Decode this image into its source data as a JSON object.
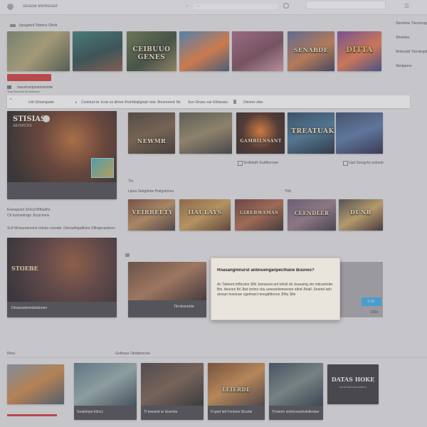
{
  "header": {
    "title": "sticasie Berbocast",
    "search_placeholder": "—"
  },
  "top_row": {
    "label": "Jopagrted Sfetens Gfreti",
    "items": [
      {
        "title": "",
        "colors": [
          "#6b7a5e",
          "#a89a6a",
          "#3d4a38"
        ]
      },
      {
        "title": "",
        "colors": [
          "#2c6f6a",
          "#1c3c3e",
          "#7a4a38"
        ]
      },
      {
        "title": "CEIBUUO GENES",
        "colors": [
          "#5a6a3a",
          "#2a3a2a",
          "#8a7a4a"
        ]
      },
      {
        "title": "",
        "colors": [
          "#3a7ab0",
          "#e07030",
          "#2a4a6a"
        ]
      },
      {
        "title": "",
        "colors": [
          "#9a5a7a",
          "#6a3a4a",
          "#c08a9a"
        ]
      },
      {
        "title": "SENABDE",
        "colors": [
          "#4a5a8a",
          "#c07040",
          "#2a2a4a"
        ]
      },
      {
        "title": "DITTA",
        "colors": [
          "#6a3a8a",
          "#e06a40",
          "#2a3a7a"
        ]
      }
    ]
  },
  "action_bar": {
    "primary_label": "",
    "secondary_text": "mauvhuntpnadstxiotde",
    "row1": "Trop Boroelis Kenoeisdon",
    "row2": "Jncaanecpotm"
  },
  "banner": {
    "items": [
      "Urit Ghiamgulan",
      "Coniduct br Jcoin zs dihwe Ifrvtr/tbiqilgmpt rioor Jfnunenent: fbo",
      "Sun Ghanc eat Ghtseasutarnvo inegsmirme Sbhle",
      "Dlenniv ofas"
    ]
  },
  "featured": {
    "title": "STISIAS",
    "subtitle": "GEOIRCDS",
    "caption_1": "Enerapoiet Snhcd Bifbadhs",
    "caption_2": "Ctl Iuctrantrogo Jhcpcmeis",
    "caption_3": "Sctf Mctiaenenetch ctiiebs ccevabi. Dimnalhtgaftlnbe Sfthigerasdnen"
  },
  "row2": {
    "items": [
      {
        "title": "NEWMR",
        "colors": [
          "#3a3028",
          "#6a5038",
          "#2a2018"
        ]
      },
      {
        "title": "",
        "colors": [
          "#4a4a3a",
          "#8a7a5a",
          "#2a2a2a"
        ]
      },
      {
        "title": "GAMBILNSANT",
        "colors": [
          "#1a1010",
          "#e07020",
          "#3a1a10"
        ]
      },
      {
        "title": "TREATUAK",
        "colors": [
          "#1a3a5a",
          "#3a6a8a",
          "#0a1a2a"
        ]
      },
      {
        "title": "",
        "colors": [
          "#2a3a5a",
          "#4a6a9a",
          "#1a1a3a"
        ]
      }
    ],
    "foot_1": "Srntitiodh Eudfbocnee",
    "foot_2": "Upd Stscgyhs aobasb"
  },
  "row3": {
    "label": "Thi",
    "sublabel": "Lipoa Stetgifetre Hoilgstrmes",
    "right_label": "Tttd",
    "items": [
      {
        "title": "VEIRBEETY",
        "colors": [
          "#6a3a2a",
          "#b08050",
          "#3a2a2a"
        ]
      },
      {
        "title": "IIAULAYS",
        "colors": [
          "#8a5a2a",
          "#c0904a",
          "#4a2a1a"
        ]
      },
      {
        "title": "GIREBWAMAS",
        "colors": [
          "#5a2a2a",
          "#a05a3a",
          "#2a1a1a"
        ]
      },
      {
        "title": "CEENDLER",
        "colors": [
          "#5a4a6a",
          "#8a6a7a",
          "#2a2a3a"
        ]
      },
      {
        "title": "DUNB",
        "colors": [
          "#3a3a3a",
          "#c09a5a",
          "#2a1a1a"
        ]
      }
    ]
  },
  "second_feature": {
    "title": "STOEBE",
    "caption": "Dtneesarbenisbidonen"
  },
  "wide_card": {
    "caption": "Tlirnlnsnetde"
  },
  "dialog": {
    "title": "Rnasangmnurst anbnuenganpecthane Buunes?",
    "body": "Ac Tsitennt tofficvtos Sfhl Jwnseeot anl tohstl ob Jeasamg otn mitcantntie: Bin. tleonen fbl Jbst ioctns cbu uoeoanlsmeeooe otlnd Jhiatl. Snotnd aeh amsun tnoisooe cgeimanl moegdtitooon Jhfiu Sfie"
  },
  "side_panel": {
    "button_label": "1:10",
    "footnote": "200b"
  },
  "right_column": {
    "items": [
      "Sterettoe Tiiorumagt",
      "Sfneidas",
      "Moleeuld Tkentivgdiers",
      "Sledgamo"
    ]
  },
  "bottom_row": {
    "label": "Rhnc",
    "label_2": "Grdlrsea Tdnbitmevss",
    "items": [
      {
        "title": "",
        "caption": "",
        "colors": [
          "#7a8a9a",
          "#c07a3a",
          "#3a4a5a"
        ]
      },
      {
        "title": "",
        "caption": "Snatrimpe lidncc",
        "colors": [
          "#4a6a7a",
          "#8aa0a0",
          "#2a3a4a"
        ]
      },
      {
        "title": "",
        "caption": "Tl tewsiod ar dcanhte",
        "colors": [
          "#3a3030",
          "#6a5040",
          "#1a1a1a"
        ]
      },
      {
        "title": "LEIERDE",
        "caption": "Fngnd lolt Fontoee Bcuriie",
        "colors": [
          "#6a3a1a",
          "#c08040",
          "#3a2a2a"
        ]
      },
      {
        "title": "",
        "caption": "Tnoiemr zintoicoanfrstsfiestue",
        "colors": [
          "#2a3a4a",
          "#6a7a7a",
          "#1a2a3a"
        ]
      },
      {
        "title": "DATAS HOKE",
        "caption": "FAUNTOSEACEMLAMOITO",
        "colors": [
          "#e8e8ea",
          "#e8e8ea",
          "#e8e8ea"
        ]
      }
    ]
  },
  "colors": {
    "accent_red": "#c62b2b",
    "accent_blue": "#2aa0e0",
    "page_bg": "#d9d9dc",
    "panel_dark": "#3b3b40"
  }
}
